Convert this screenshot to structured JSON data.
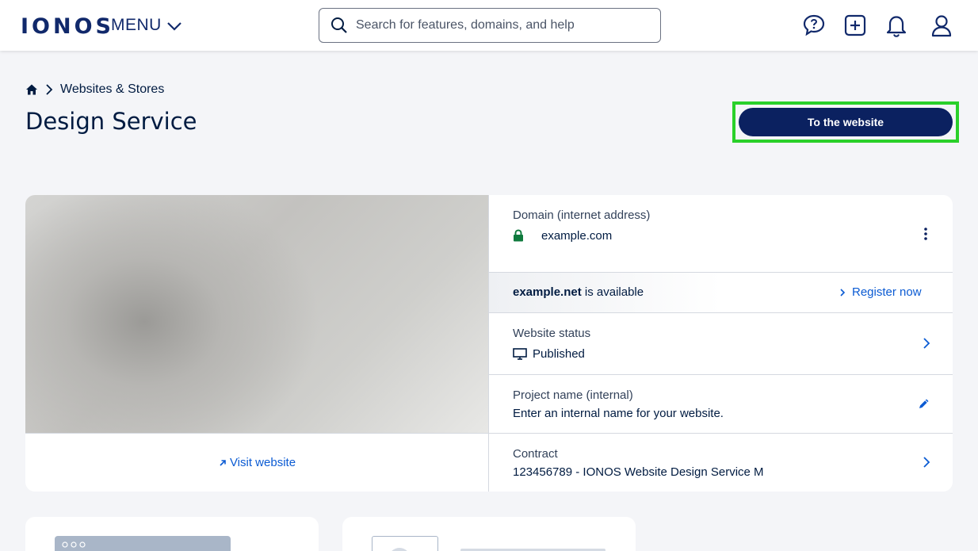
{
  "header": {
    "logo": "IONOS",
    "menu_label": "MENU",
    "search_placeholder": "Search for features, domains, and help"
  },
  "breadcrumb": {
    "section": "Websites & Stores"
  },
  "page": {
    "title": "Design Service",
    "cta_label": "To the website"
  },
  "card": {
    "visit_label": "Visit website",
    "domain": {
      "label": "Domain (internet address)",
      "value": "example.com"
    },
    "availability": {
      "domain": "example.net",
      "suffix": "is available",
      "action": "Register now"
    },
    "status": {
      "label": "Website status",
      "value": "Published"
    },
    "project": {
      "label": "Project name (internal)",
      "value": "Enter an internal name for your website."
    },
    "contract": {
      "label": "Contract",
      "value": "123456789 - IONOS Website Design Service M"
    }
  },
  "colors": {
    "brand": "#11296b",
    "cta": "#0b2160",
    "highlight": "#2ad02a",
    "link": "#0b5bd3",
    "lock": "#0f7a3d"
  }
}
